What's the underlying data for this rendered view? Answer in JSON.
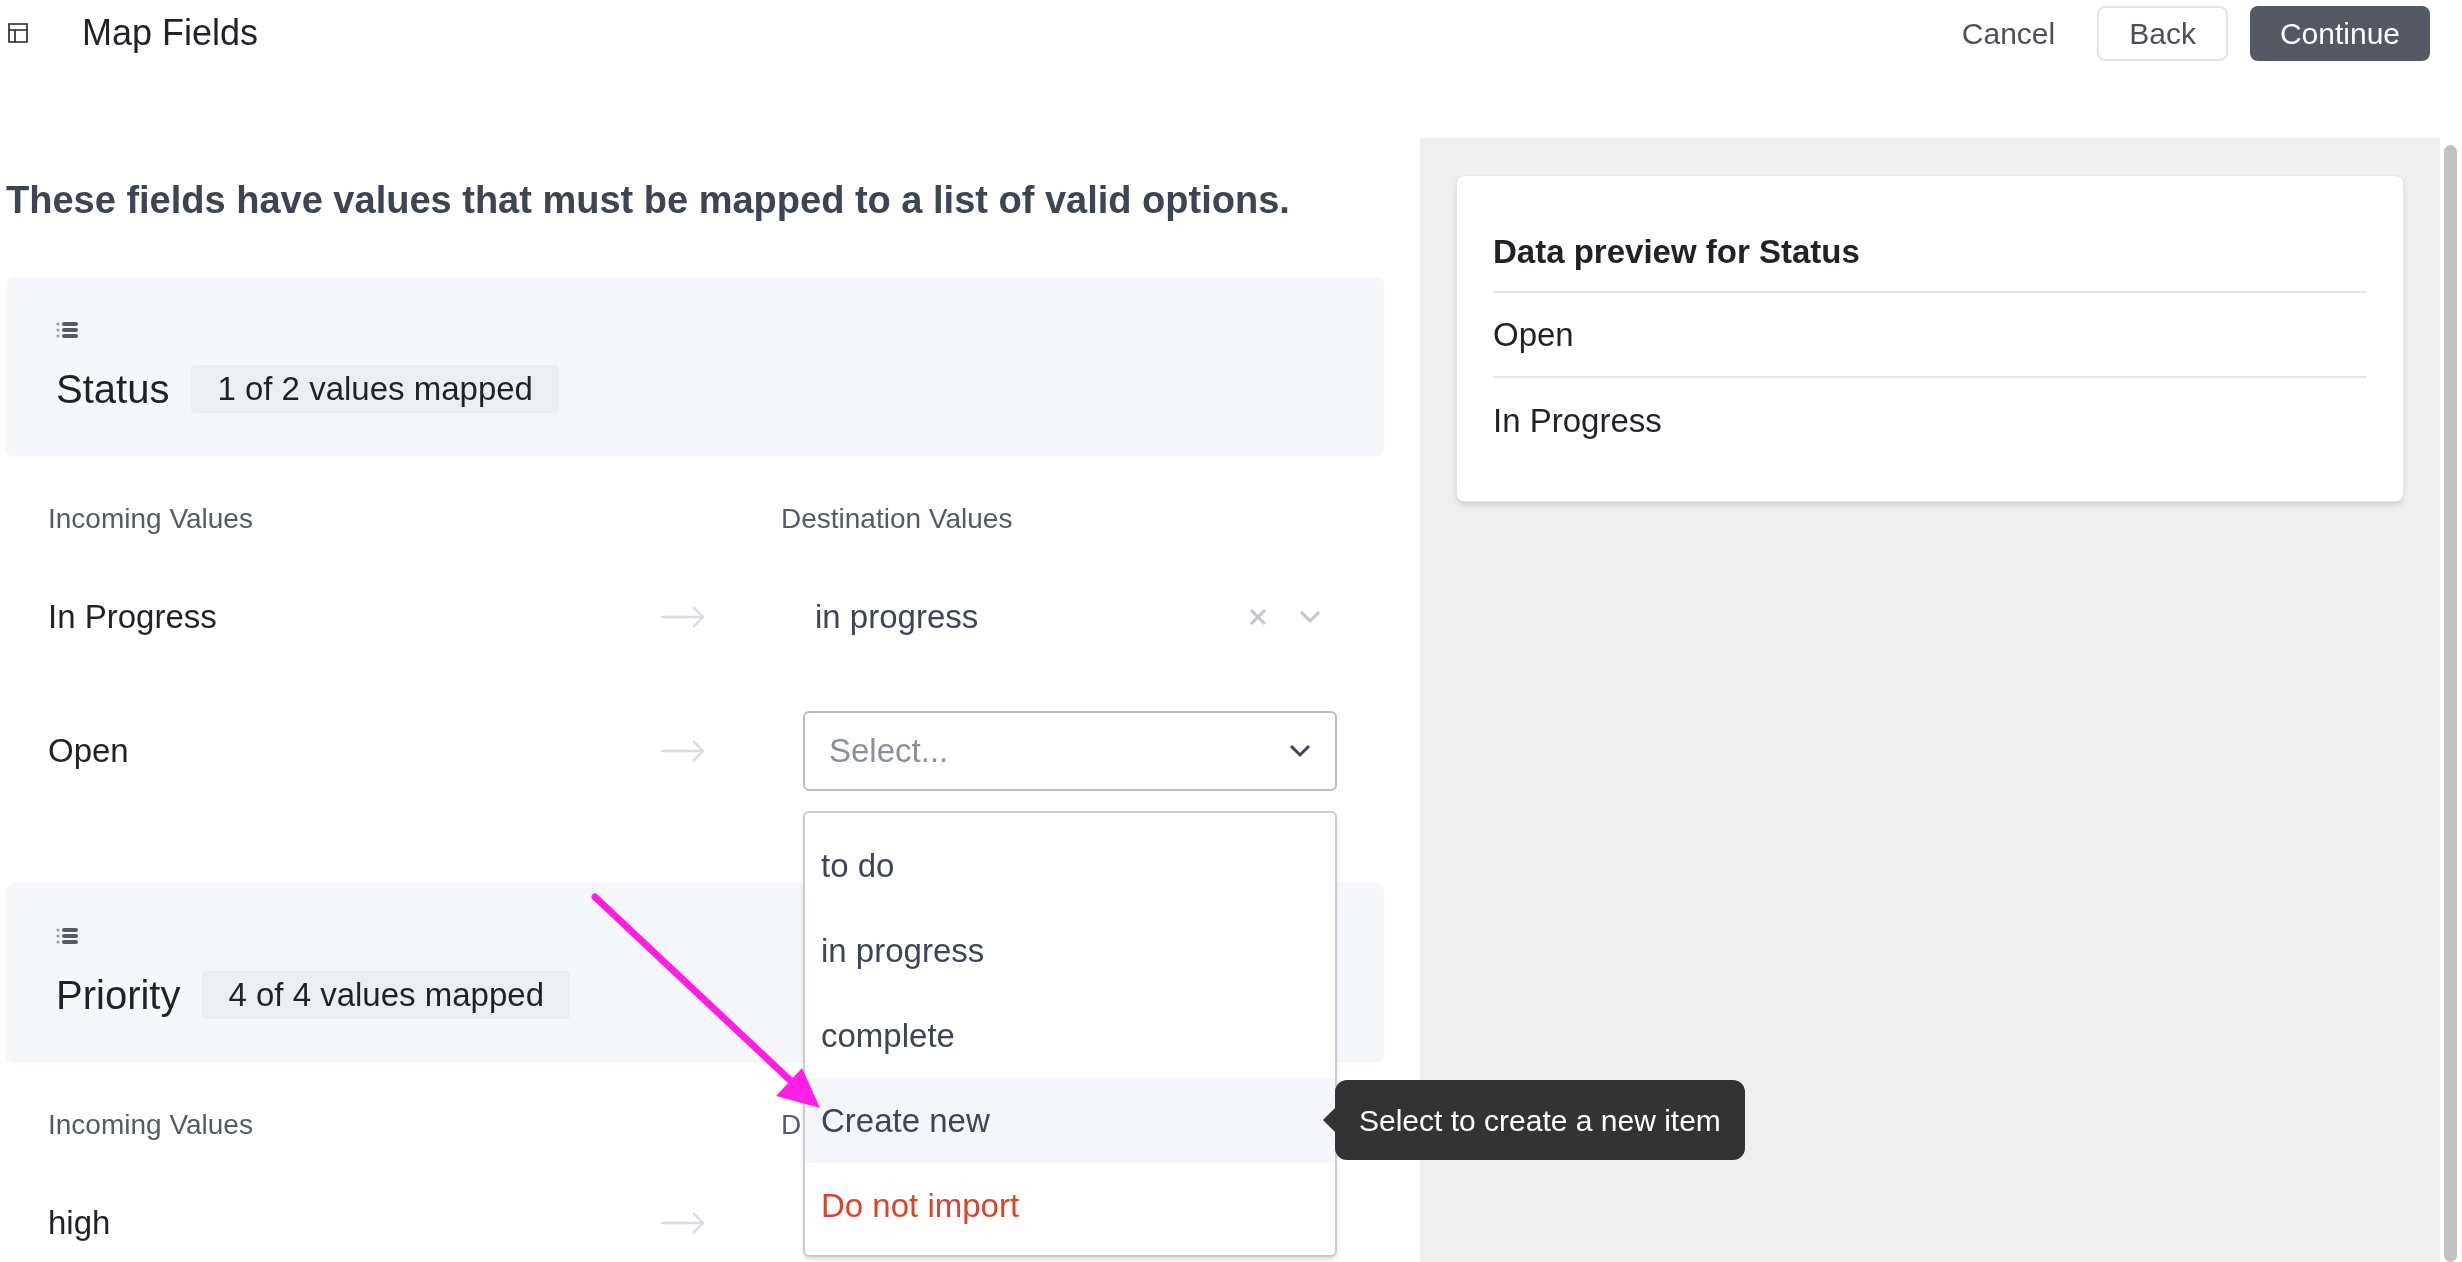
{
  "header": {
    "title": "Map Fields",
    "buttons": [
      {
        "label": "Cancel",
        "kind": "text"
      },
      {
        "label": "Back",
        "kind": "outline"
      },
      {
        "label": "Continue",
        "kind": "primary"
      }
    ]
  },
  "instructions": "These fields have values that must be mapped to a list of valid options.",
  "fields": [
    {
      "name": "Status",
      "badge": "1 of 2 values mapped",
      "columns": [
        "Incoming Values",
        "Destination Values"
      ],
      "rows": [
        {
          "incoming": "In Progress",
          "destination": {
            "kind": "value",
            "value": "in progress"
          }
        },
        {
          "incoming": "Open",
          "destination": {
            "kind": "select",
            "placeholder": "Select...",
            "expanded": true,
            "options": [
              {
                "label": "to do",
                "kind": "normal",
                "highlighted": false
              },
              {
                "label": "in progress",
                "kind": "normal",
                "highlighted": false
              },
              {
                "label": "complete",
                "kind": "normal",
                "highlighted": false
              },
              {
                "label": "Create new",
                "kind": "normal",
                "highlighted": true,
                "tooltip": "Select to create a new item"
              },
              {
                "label": "Do not import",
                "kind": "danger",
                "highlighted": false
              }
            ]
          }
        }
      ]
    },
    {
      "name": "Priority",
      "badge": "4 of 4 values mapped",
      "columns": [
        "Incoming Values",
        "D"
      ],
      "rows": [
        {
          "incoming": "high"
        }
      ]
    }
  ],
  "preview": {
    "title": "Data preview for Status",
    "rows": [
      "Open",
      "In Progress"
    ]
  }
}
